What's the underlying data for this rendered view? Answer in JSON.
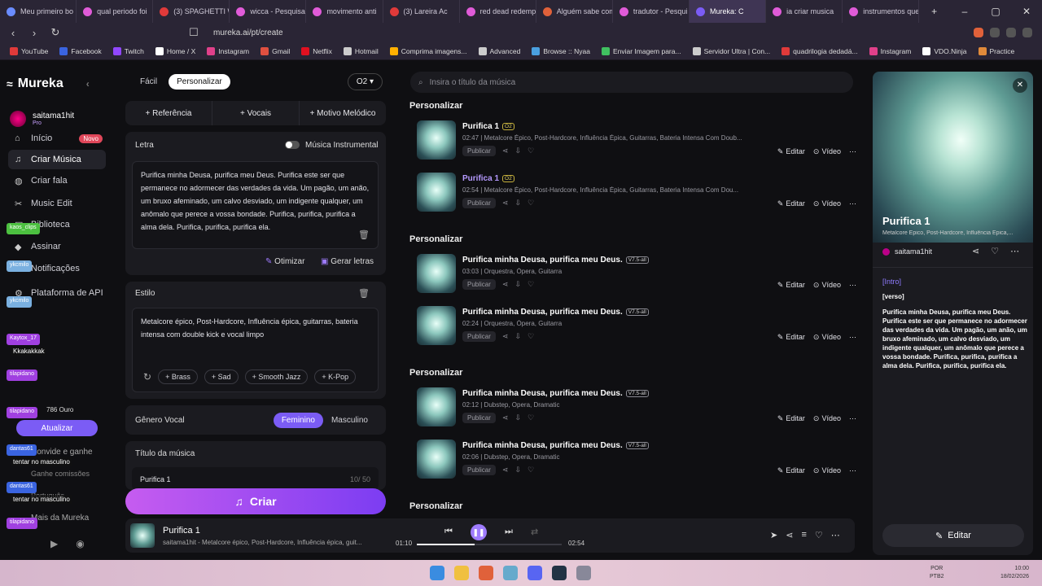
{
  "browser": {
    "tabs": [
      {
        "label": "Meu primeiro bo",
        "color": "#6a8cff"
      },
      {
        "label": "qual periodo foi",
        "color": "#e05bd8"
      },
      {
        "label": "(3) SPAGHETTI W",
        "color": "#e03a3a"
      },
      {
        "label": "wicca - Pesquisa",
        "color": "#e05bd8"
      },
      {
        "label": "movimento anti",
        "color": "#e05bd8"
      },
      {
        "label": "(3) Lareira Ac",
        "color": "#e03a3a"
      },
      {
        "label": "red dead redemp",
        "color": "#e05bd8"
      },
      {
        "label": "Alguém sabe com",
        "color": "#e0613a"
      },
      {
        "label": "tradutor - Pesqui",
        "color": "#e05bd8"
      },
      {
        "label": "Mureka: C",
        "color": "#7b5cf5",
        "active": true
      },
      {
        "label": "ia criar musica",
        "color": "#e05bd8"
      },
      {
        "label": "instrumentos que",
        "color": "#e05bd8"
      }
    ],
    "url": "mureka.ai/pt/create",
    "bookmarks": [
      {
        "label": "YouTube",
        "color": "#e03a3a"
      },
      {
        "label": "Facebook",
        "color": "#3a64e0"
      },
      {
        "label": "Twitch",
        "color": "#9147ff"
      },
      {
        "label": "Home / X",
        "color": "#ffffff"
      },
      {
        "label": "Instagram",
        "color": "#e0408a"
      },
      {
        "label": "Gmail",
        "color": "#e05040"
      },
      {
        "label": "Netflix",
        "color": "#e01020"
      },
      {
        "label": "Hotmail",
        "color": "#cccccc"
      },
      {
        "label": "Comprima imagens...",
        "color": "#ffb000"
      },
      {
        "label": "Advanced",
        "color": "#cccccc"
      },
      {
        "label": "Browse :: Nyaa",
        "color": "#4aa0e0"
      },
      {
        "label": "Enviar Imagem para...",
        "color": "#40c060"
      },
      {
        "label": "Servidor Ultra | Con...",
        "color": "#cccccc"
      },
      {
        "label": "quadrilogia dedadá...",
        "color": "#e03a3a"
      },
      {
        "label": "Instagram",
        "color": "#e0408a"
      },
      {
        "label": "VDO.Ninja",
        "color": "#ffffff"
      },
      {
        "label": "Practice",
        "color": "#e08a3a"
      }
    ]
  },
  "app": {
    "logo": "Mureka",
    "user": {
      "name": "saitama1hit",
      "plan": "Pro"
    },
    "nav": [
      {
        "label": "Início",
        "badge": "Novo"
      },
      {
        "label": "Criar Música",
        "selected": true
      },
      {
        "label": "Criar fala"
      },
      {
        "label": "Music Edit"
      },
      {
        "label": "Biblioteca"
      },
      {
        "label": "Assinar"
      },
      {
        "label": "Notificações"
      },
      {
        "label": "Plataforma de API"
      }
    ],
    "credits": "786 Ouro",
    "update_label": "Atualizar",
    "invite": "Convide e ganhe",
    "commission": "Ganhe comissões",
    "language": "Português",
    "more": "Mais da Mureka",
    "chat_overlay": [
      {
        "user": "kaos_clips",
        "msg": ""
      },
      {
        "user": "ykcmilo",
        "msg": ""
      },
      {
        "user": "ykcmilo",
        "msg": ""
      },
      {
        "user": "Kaytox_17",
        "msg": "Kkakakkak"
      },
      {
        "user": "tilapidano",
        "msg": ""
      },
      {
        "user": "tilapidano",
        "msg": ""
      },
      {
        "user": "dantas61",
        "msg": "tentar no masculino"
      },
      {
        "user": "dantas61",
        "msg": "tentar no masculino"
      },
      {
        "user": "tilapidano",
        "msg": ""
      }
    ]
  },
  "create": {
    "mode_easy": "Fácil",
    "mode_custom": "Personalizar",
    "model": "O2",
    "tools": [
      "+ Referência",
      "+ Vocais",
      "+ Motivo Melódico"
    ],
    "lyrics_label": "Letra",
    "instrumental_label": "Música Instrumental",
    "lyrics": "Purifica minha Deusa, purifica meu Deus. Purifica este ser que permanece no adormecer das verdades da vida. Um pagão, um anão, um bruxo afeminado, um calvo desviado, um indigente qualquer, um anômalo que perece a vossa bondade. Purifica, purifica, purifica a alma dela. Purifica, purifica, purifica ela.",
    "optimize": "Otimizar",
    "generate_lyrics": "Gerar letras",
    "style_label": "Estilo",
    "style": "Metalcore épico, Post-Hardcore, Influência épica, guitarras, bateria intensa com double kick e vocal limpo",
    "style_chips": [
      "+ Brass",
      "+ Sad",
      "+ Smooth Jazz",
      "+ K-Pop"
    ],
    "vocal_label": "Gênero Vocal",
    "vocal_female": "Feminino",
    "vocal_male": "Masculino",
    "title_label": "Título da música",
    "title_value": "Purifica 1",
    "title_count": "10/ 50",
    "create_button": "Criar"
  },
  "list": {
    "search_placeholder": "Insira o título da música",
    "sections": [
      {
        "heading": "Personalizar",
        "songs": [
          {
            "title": "Purifica 1",
            "version": "O2",
            "meta": "02:47 | Metalcore Épico, Post-Hardcore, Influência Épica, Guitarras, Bateria Intensa Com Doub...",
            "purple": false
          },
          {
            "title": "Purifica 1",
            "version": "O2",
            "meta": "02:54 | Metalcore Épico, Post-Hardcore, Influência Épica, Guitarras, Bateria Intensa Com Dou...",
            "purple": true
          }
        ]
      },
      {
        "heading": "Personalizar",
        "songs": [
          {
            "title": "Purifica minha Deusa, purifica meu Deus.",
            "version": "V7.5-all",
            "meta": "03:03 | Orquestra, Ópera, Guitarra",
            "purple": false
          },
          {
            "title": "Purifica minha Deusa, purifica meu Deus.",
            "version": "V7.5-all",
            "meta": "02:24 | Orquestra, Ópera, Guitarra",
            "purple": false
          }
        ]
      },
      {
        "heading": "Personalizar",
        "songs": [
          {
            "title": "Purifica minha Deusa, purifica meu Deus.",
            "version": "V7.5-all",
            "meta": "02:12 | Dubstep, Opera, Dramatic",
            "purple": false
          },
          {
            "title": "Purifica minha Deusa, purifica meu Deus.",
            "version": "V7.5-all",
            "meta": "02:06 | Dubstep, Opera, Dramatic",
            "purple": false
          }
        ]
      },
      {
        "heading": "Personalizar",
        "songs": []
      }
    ],
    "publish": "Publicar",
    "edit": "Editar",
    "video": "Vídeo"
  },
  "detail": {
    "title": "Purifica 1",
    "tags": "Metalcore Épico, Post-Hardcore, Influência Épica,...",
    "author": "saitama1hit",
    "intro": "[Intro]",
    "verse": "[verso]",
    "lyrics": "Purifica minha Deusa, purifica meu Deus. Purifica este ser que permanece no adormecer das verdades da vida. Um pagão, um anão, um bruxo afeminado, um calvo desviado, um indigente qualquer, um anômalo que perece a vossa bondade. Purifica, purifica, purifica a alma dela. Purifica, purifica, purifica ela.",
    "edit": "Editar"
  },
  "player": {
    "title": "Purifica 1",
    "subtitle": "saitama1hit - Metalcore épico, Post-Hardcore, Influência épica, guit...",
    "current": "01:10",
    "total": "02:54",
    "progress": 0.4
  },
  "taskbar": {
    "lang": "POR",
    "layout": "PTB2",
    "time": "10:00",
    "date": "18/02/2026"
  }
}
